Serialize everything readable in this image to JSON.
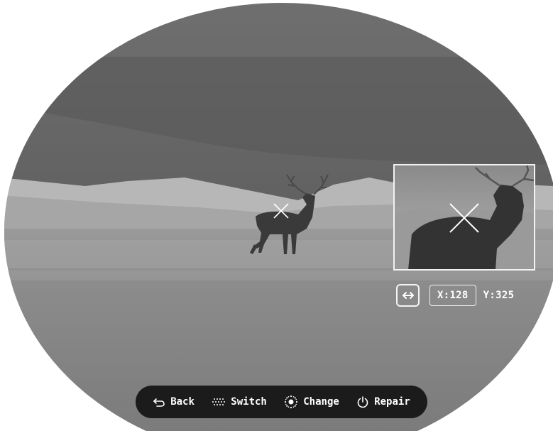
{
  "viewer": {
    "scene": "thermal monochrome view of a red deer stag standing on a plain with hills and overcast sky",
    "reticle": "x-crosshair-icon"
  },
  "zoom_window": {
    "coords": {
      "x_label": "X:128",
      "y_label": "Y:325"
    },
    "mode_icon": "horizontal-arrows-icon"
  },
  "bottom_bar": {
    "items": [
      {
        "label": "Back",
        "icon": "back-arrow-icon"
      },
      {
        "label": "Switch",
        "icon": "dotted-grid-icon"
      },
      {
        "label": "Change",
        "icon": "dotted-sun-icon"
      },
      {
        "label": "Repair",
        "icon": "power-icon"
      }
    ]
  },
  "colors": {
    "bar_background": "#1b1b1b",
    "frame_outline": "#f2f2f2",
    "text": "#ffffff"
  }
}
